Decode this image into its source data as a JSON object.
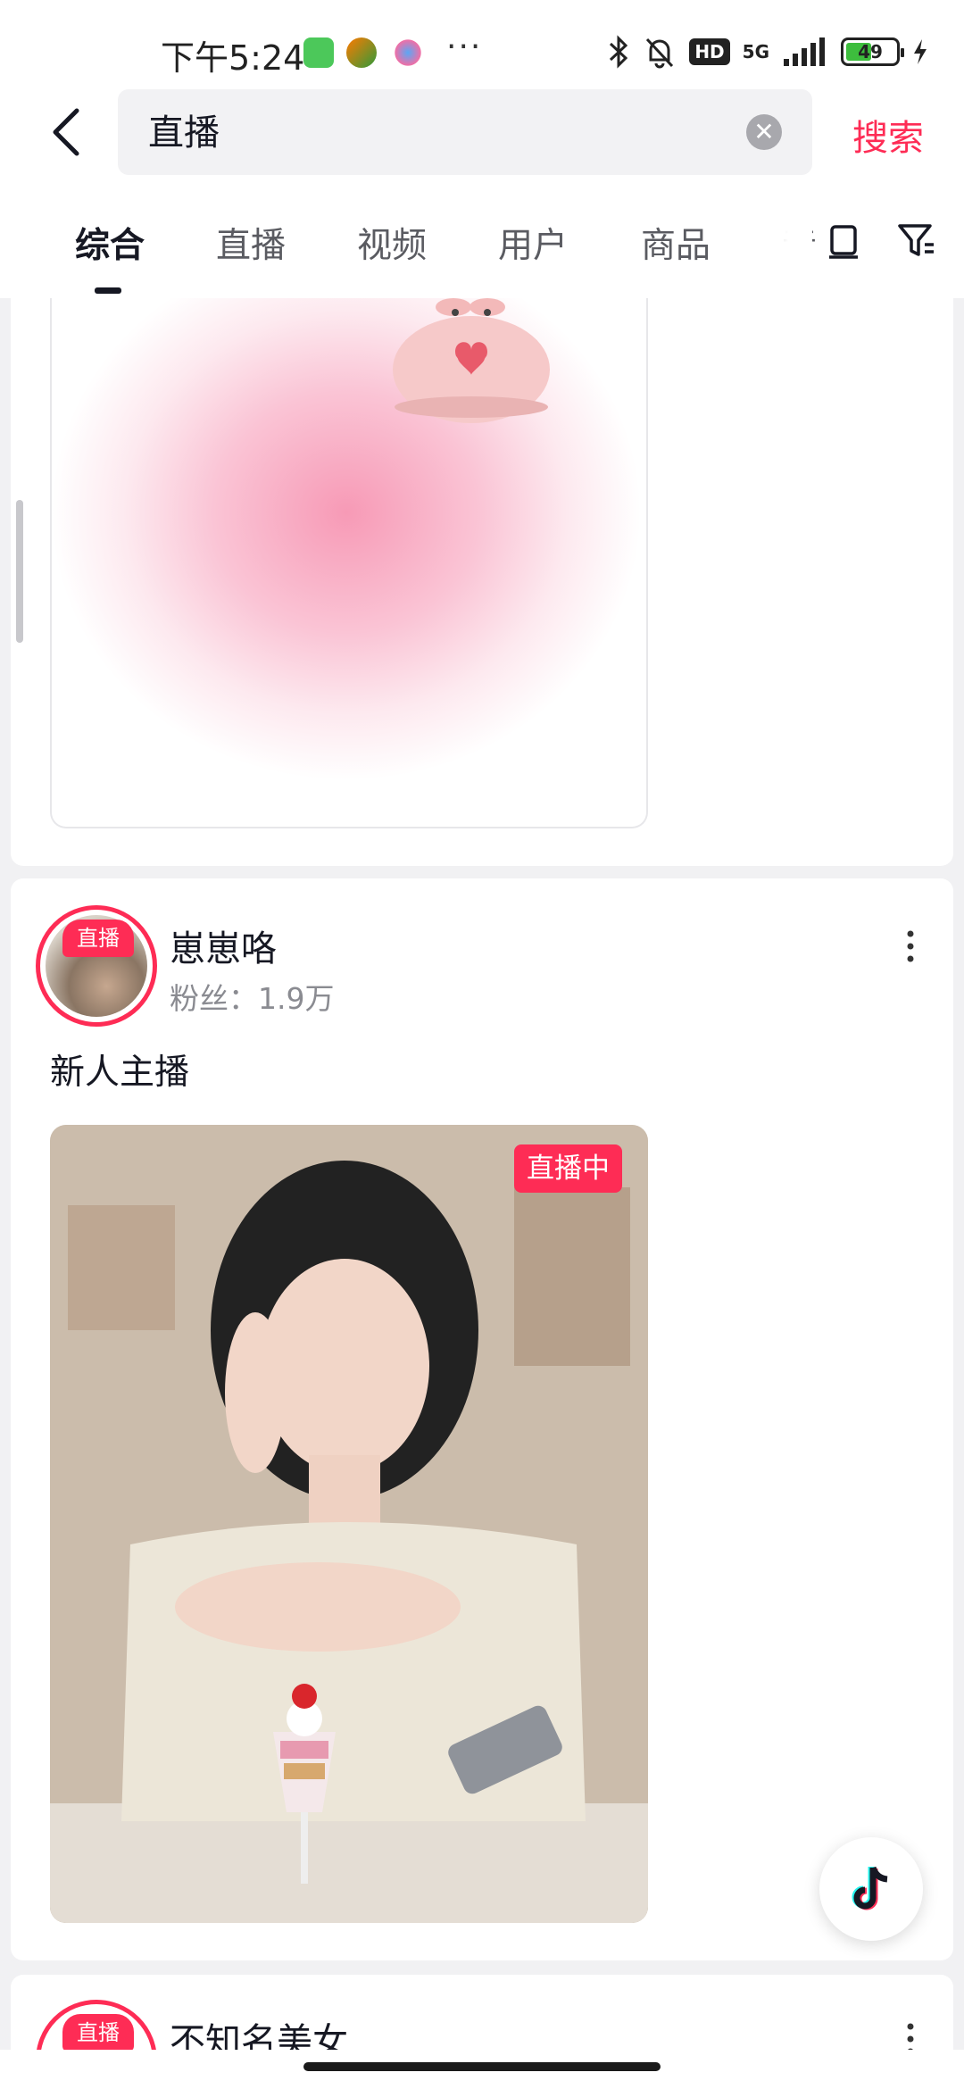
{
  "status_bar": {
    "time": "下午5:24",
    "network": "5G",
    "hd_label": "HD",
    "battery_level": "49",
    "dots": "···"
  },
  "search": {
    "query": "直播",
    "button_label": "搜索"
  },
  "tabs": [
    {
      "label": "综合",
      "active": true
    },
    {
      "label": "直播",
      "active": false
    },
    {
      "label": "视频",
      "active": false
    },
    {
      "label": "用户",
      "active": false
    },
    {
      "label": "商品",
      "active": false
    },
    {
      "label": "音",
      "active": false
    }
  ],
  "results": [
    {
      "avatar_live_label": "直播",
      "user_name": "崽崽咯",
      "fans": "粉丝：1.9万",
      "description": "新人主播",
      "live_badge": "直播中"
    },
    {
      "avatar_live_label": "直播",
      "user_name": "不知名美女"
    }
  ],
  "colors": {
    "accent": "#fe2c55",
    "text_primary": "#161823",
    "text_secondary": "#8a8b91"
  }
}
